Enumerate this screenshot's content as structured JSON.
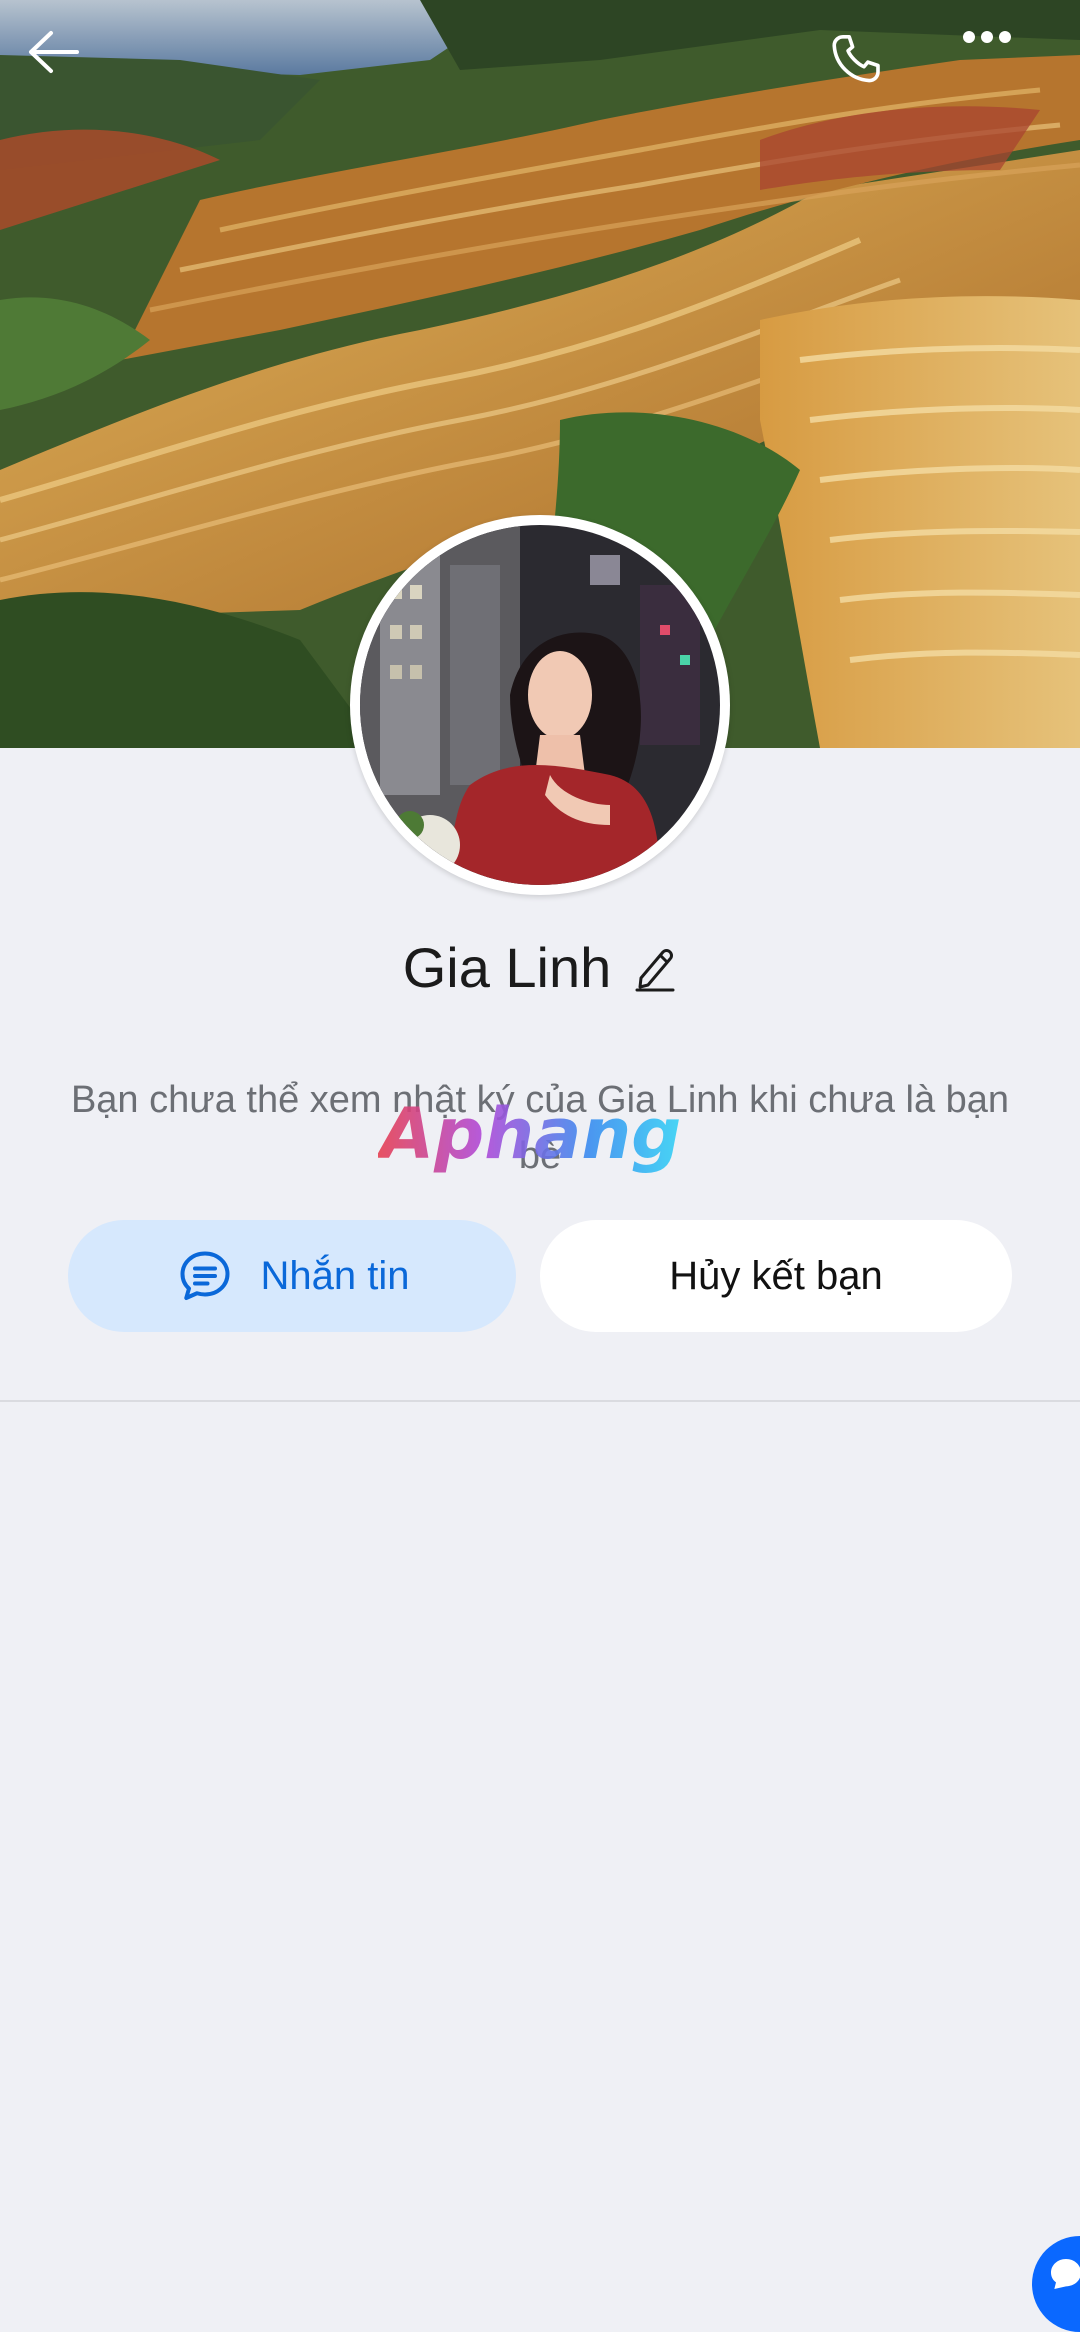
{
  "header": {
    "back_icon": "arrow-left-icon",
    "call_icon": "phone-icon",
    "more_icon": "more-horizontal-icon"
  },
  "profile": {
    "name": "Gia Linh",
    "edit_icon": "pencil-icon",
    "privacy_notice": "Bạn chưa thể xem nhật ký của Gia Linh khi chưa là bạn bè"
  },
  "actions": {
    "message_label": "Nhắn tin",
    "message_icon": "chat-bubble-icon",
    "unfriend_label": "Hủy kết bạn"
  },
  "watermark": {
    "text": "Aphang"
  },
  "colors": {
    "primary": "#0a68d9",
    "message_button_bg": "#d6e8fd",
    "background": "#eff0f5"
  }
}
